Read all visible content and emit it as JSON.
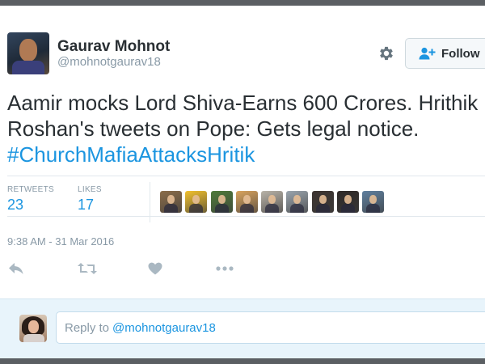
{
  "user": {
    "name": "Gaurav Mohnot",
    "handle": "@mohnotgaurav18"
  },
  "actions_top": {
    "follow_label": "Follow",
    "settings_icon": "gear-icon",
    "follow_icon": "add-user-icon"
  },
  "tweet": {
    "text_plain": "Aamir mocks Lord Shiva-Earns 600 Crores. Hrithik Roshan's tweets on Pope: Gets legal notice.",
    "hashtag": "#ChurchMafiaAttacksHritik"
  },
  "stats": {
    "retweets_label": "RETWEETS",
    "retweets_value": "23",
    "likes_label": "LIKES",
    "likes_value": "17"
  },
  "likers": [
    {
      "name": "liker-1",
      "color": "#8b6d4a"
    },
    {
      "name": "liker-2",
      "color": "#f2c12e"
    },
    {
      "name": "liker-3",
      "color": "#4e7a3a"
    },
    {
      "name": "liker-4",
      "color": "#d9a35e"
    },
    {
      "name": "liker-5",
      "color": "#b9b3a8"
    },
    {
      "name": "liker-6",
      "color": "#9aa4ad"
    },
    {
      "name": "liker-7",
      "color": "#3c3430"
    },
    {
      "name": "liker-8",
      "color": "#2f2a28"
    },
    {
      "name": "liker-9",
      "color": "#5f7f9e"
    }
  ],
  "timestamp": "9:38 AM - 31 Mar 2016",
  "tweet_actions": [
    "reply-icon",
    "retweet-icon",
    "like-icon",
    "more-icon"
  ],
  "reply": {
    "prefix": "Reply to",
    "mention": "@mohnotgaurav18"
  },
  "colors": {
    "link": "#1b95e0",
    "muted": "#8899a6",
    "text": "#292f33",
    "reply_bg": "#e8f4fb"
  }
}
